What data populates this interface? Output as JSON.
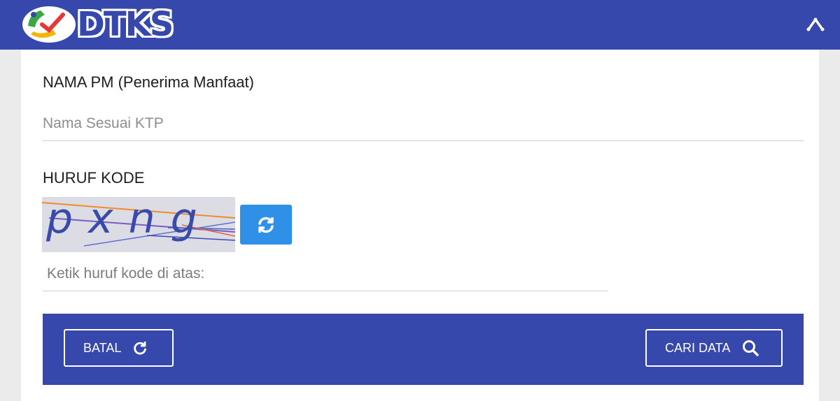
{
  "header": {
    "logo_text": "DTKS",
    "logo_icon": "dtks-logo-icon",
    "collapse_icon": "chevron-up-icon",
    "bar_color": "#3648ab"
  },
  "form": {
    "name_label": "NAMA PM (Penerima Manfaat)",
    "name_placeholder": "Nama Sesuai KTP",
    "name_value": "",
    "code_label": "HURUF KODE",
    "captcha_text": "pxng",
    "refresh_icon": "refresh-icon",
    "code_placeholder": "Ketik huruf kode di atas:",
    "code_value": ""
  },
  "footer": {
    "cancel_label": "BATAL",
    "cancel_icon": "reload-icon",
    "search_label": "CARI DATA",
    "search_icon": "search-icon"
  },
  "colors": {
    "primary": "#3648ab",
    "refresh_button": "#2f90e8"
  }
}
